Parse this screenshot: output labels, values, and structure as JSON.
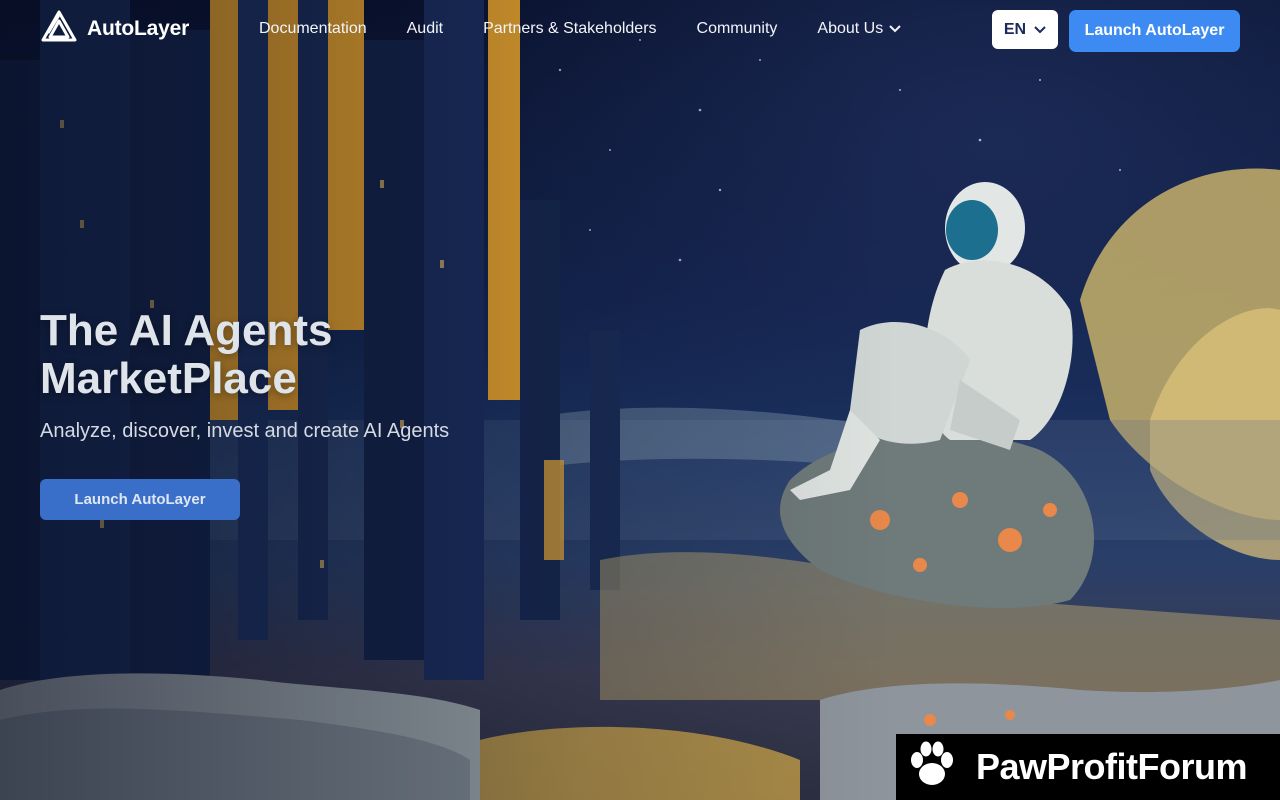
{
  "brand": {
    "name": "AutoLayer"
  },
  "nav": {
    "links": [
      "Documentation",
      "Audit",
      "Partners & Stakeholders",
      "Community"
    ],
    "about": "About Us",
    "language": "EN",
    "cta": "Launch AutoLayer"
  },
  "hero": {
    "title_line1": "The AI Agents",
    "title_line2": "MarketPlace",
    "subtitle": "Analyze, discover, invest and create AI Agents",
    "cta": "Launch AutoLayer"
  },
  "watermark": {
    "text": "PawProfitForum"
  },
  "colors": {
    "accent": "#3d8bf2",
    "hero_button": "#3a6fc9",
    "sky_top": "#0a1230",
    "gold": "#e8a32b"
  },
  "icons": [
    "autolayer-logo-icon",
    "chevron-down-icon",
    "paw-icon"
  ]
}
